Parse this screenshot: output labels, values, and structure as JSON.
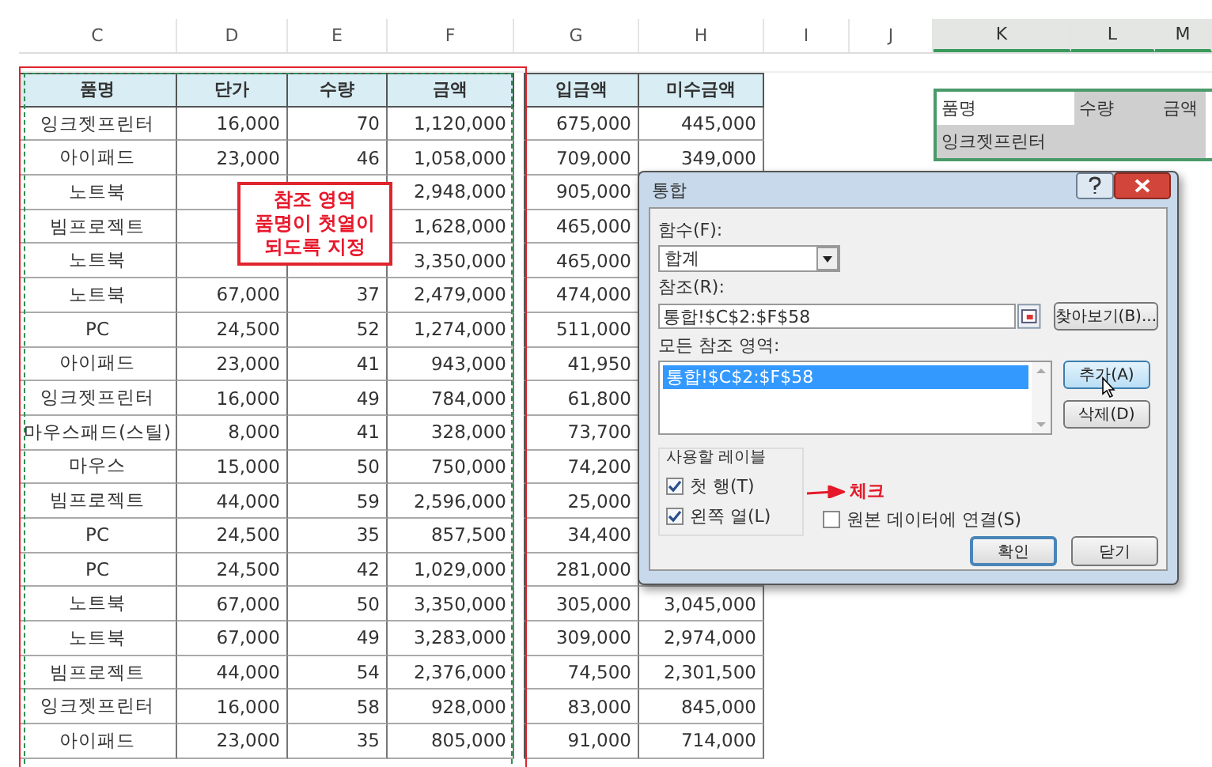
{
  "sheet": {
    "column_headers": [
      "C",
      "D",
      "E",
      "F",
      "G",
      "H",
      "I",
      "J",
      "K",
      "L",
      "M"
    ],
    "table": {
      "columns": [
        "품명",
        "단가",
        "수량",
        "금액",
        "입금액",
        "미수금액"
      ],
      "rows": [
        [
          "잉크젯프린터",
          "16,000",
          "70",
          "1,120,000",
          "675,000",
          "445,000"
        ],
        [
          "아이패드",
          "23,000",
          "46",
          "1,058,000",
          "709,000",
          "349,000"
        ],
        [
          "노트북",
          null,
          null,
          "2,948,000",
          "905,000",
          null
        ],
        [
          "빔프로젝트",
          null,
          null,
          "1,628,000",
          "465,000",
          null
        ],
        [
          "노트북",
          null,
          null,
          "3,350,000",
          "465,000",
          null
        ],
        [
          "노트북",
          "67,000",
          "37",
          "2,479,000",
          "474,000",
          null
        ],
        [
          "PC",
          "24,500",
          "52",
          "1,274,000",
          "511,000",
          null
        ],
        [
          "아이패드",
          "23,000",
          "41",
          "943,000",
          "41,950",
          null
        ],
        [
          "잉크젯프린터",
          "16,000",
          "49",
          "784,000",
          "61,800",
          null
        ],
        [
          "마우스패드(스틸)",
          "8,000",
          "41",
          "328,000",
          "73,700",
          null
        ],
        [
          "마우스",
          "15,000",
          "50",
          "750,000",
          "74,200",
          null
        ],
        [
          "빔프로젝트",
          "44,000",
          "59",
          "2,596,000",
          "25,000",
          null
        ],
        [
          "PC",
          "24,500",
          "35",
          "857,500",
          "34,400",
          null
        ],
        [
          "PC",
          "24,500",
          "42",
          "1,029,000",
          "281,000",
          null
        ],
        [
          "노트북",
          "67,000",
          "50",
          "3,350,000",
          "305,000",
          "3,045,000"
        ],
        [
          "노트북",
          "67,000",
          "49",
          "3,283,000",
          "309,000",
          "2,974,000"
        ],
        [
          "빔프로젝트",
          "44,000",
          "54",
          "2,376,000",
          "74,500",
          "2,301,500"
        ],
        [
          "잉크젯프린터",
          "16,000",
          "58",
          "928,000",
          "83,000",
          "845,000"
        ],
        [
          "아이패드",
          "23,000",
          "35",
          "805,000",
          "91,000",
          "714,000"
        ]
      ]
    },
    "summary_table": {
      "columns": [
        "품명",
        "수량",
        "금액"
      ],
      "rows": [
        [
          "잉크젯프린터"
        ]
      ]
    }
  },
  "annotation": {
    "lines": [
      "참조 영역",
      "품명이 첫열이",
      "되도록 지정"
    ]
  },
  "dialog": {
    "title": "통합",
    "function_label": "함수(F):",
    "function_value": "합계",
    "reference_label": "참조(R):",
    "reference_value": "통합!$C$2:$F$58",
    "browse_button": "찾아보기(B)...",
    "all_references_label": "모든 참조 영역:",
    "all_references": [
      {
        "text": "통합!$C$2:$F$58",
        "selected": true
      }
    ],
    "add_button": "추가(A)",
    "delete_button": "삭제(D)",
    "labels_group": "사용할 레이블",
    "checkboxes": [
      {
        "label": "첫 행(T)",
        "checked": true
      },
      {
        "label": "왼쪽 열(L)",
        "checked": true
      },
      {
        "label": "원본 데이터에 연결(S)",
        "checked": false
      }
    ],
    "check_note": "체크",
    "ok_button": "확인",
    "close_button": "닫기"
  }
}
